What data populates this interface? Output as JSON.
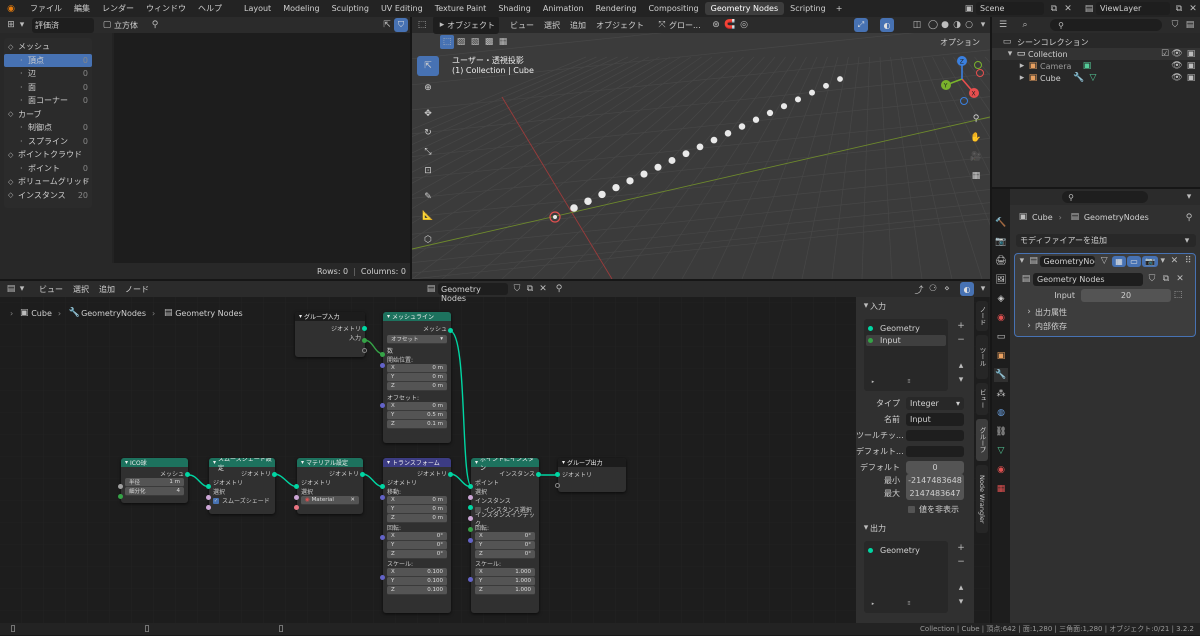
{
  "topbar": {
    "menus": [
      "ファイル",
      "編集",
      "レンダー",
      "ウィンドウ",
      "ヘルプ"
    ],
    "tabs": [
      "Layout",
      "Modeling",
      "Sculpting",
      "UV Editing",
      "Texture Paint",
      "Shading",
      "Animation",
      "Rendering",
      "Compositing",
      "Geometry Nodes",
      "Scripting"
    ],
    "active_tab": "Geometry Nodes",
    "plus": "+",
    "scene": "Scene",
    "view_layer": "ViewLayer"
  },
  "spreadsheet": {
    "mode": "評価済",
    "object": "立方体",
    "categories": [
      {
        "group": "メッシュ",
        "items": [
          {
            "label": "頂点",
            "count": "0"
          },
          {
            "label": "辺",
            "count": "0"
          },
          {
            "label": "面",
            "count": "0"
          },
          {
            "label": "面コーナー",
            "count": "0"
          }
        ]
      },
      {
        "group": "カーブ",
        "items": [
          {
            "label": "制御点",
            "count": "0"
          },
          {
            "label": "スプライン",
            "count": "0"
          }
        ]
      },
      {
        "group": "ポイントクラウド",
        "items": [
          {
            "label": "ポイント",
            "count": "0"
          }
        ]
      },
      {
        "group": "ボリュームグリッド",
        "items": [],
        "count": "0"
      },
      {
        "group": "インスタンス",
        "items": [],
        "count": "20"
      }
    ],
    "status": {
      "rows": "Rows: 0",
      "columns": "Columns: 0"
    }
  },
  "viewport": {
    "mode": "オブジェクト",
    "menus": [
      "ビュー",
      "選択",
      "追加",
      "オブジェクト"
    ],
    "transform": "グロー...",
    "options": "オプション",
    "view_label": "ユーザー・透視投影",
    "collection_label": "(1) Collection | Cube"
  },
  "outliner": {
    "title": "シーンコレクション",
    "collection": "Collection",
    "items": [
      "Camera",
      "Cube"
    ]
  },
  "properties": {
    "breadcrumb": [
      "Cube",
      "GeometryNodes"
    ],
    "add_modifier": "モディファイアーを追加",
    "modifier_name": "GeometryNod...",
    "node_group": "Geometry Nodes",
    "input_label": "Input",
    "input_value": "20",
    "panels": [
      "出力属性",
      "内部依存"
    ]
  },
  "node_editor": {
    "menus": [
      "ビュー",
      "選択",
      "追加",
      "ノード"
    ],
    "node_group": "Geometry Nodes",
    "breadcrumb": [
      "Cube",
      "GeometryNodes",
      "Geometry Nodes"
    ]
  },
  "nodes": {
    "group_input": {
      "title": "グループ入力",
      "rows": [
        "ジオメトリ",
        "入力"
      ]
    },
    "mesh_line": {
      "title": "メッシュライン",
      "out": "メッシュ",
      "mode": "オフセット",
      "count": "数",
      "start": "開始位置:",
      "start_vals": [
        [
          "X",
          "0 m"
        ],
        [
          "Y",
          "0 m"
        ],
        [
          "Z",
          "0 m"
        ]
      ],
      "offset": "オフセット:",
      "offset_vals": [
        [
          "X",
          "0 m"
        ],
        [
          "Y",
          "0.5 m"
        ],
        [
          "Z",
          "0.1 m"
        ]
      ]
    },
    "ico": {
      "title": "ICO球",
      "out": "メッシュ",
      "fields": [
        [
          "半径",
          "1 m"
        ],
        [
          "細分化",
          "4"
        ]
      ]
    },
    "smooth": {
      "title": "スムーズシェード設定",
      "out": "ジオメトリ",
      "rows": [
        "ジオメトリ",
        "選択"
      ],
      "check": "スムーズシェード"
    },
    "material": {
      "title": "マテリアル設定",
      "out": "ジオメトリ",
      "rows": [
        "ジオメトリ",
        "選択"
      ],
      "material": "Material"
    },
    "transform": {
      "title": "トランスフォーム",
      "out": "ジオメトリ",
      "in": "ジオメトリ",
      "move": "移動:",
      "move_vals": [
        [
          "X",
          "0 m"
        ],
        [
          "Y",
          "0 m"
        ],
        [
          "Z",
          "0 m"
        ]
      ],
      "rot": "回転:",
      "rot_vals": [
        [
          "X",
          "0°"
        ],
        [
          "Y",
          "0°"
        ],
        [
          "Z",
          "0°"
        ]
      ],
      "scale": "スケール:",
      "scale_vals": [
        [
          "X",
          "0.100"
        ],
        [
          "Y",
          "0.100"
        ],
        [
          "Z",
          "0.100"
        ]
      ]
    },
    "instance": {
      "title": "ポイントにインスタン",
      "out": "インスタンス",
      "rows": [
        "ポイント",
        "選択",
        "インスタンス"
      ],
      "check": "インスタンス選択",
      "idx": "インスタンスインデック",
      "rot": "回転:",
      "rot_vals": [
        [
          "X",
          "0°"
        ],
        [
          "Y",
          "0°"
        ],
        [
          "Z",
          "0°"
        ]
      ],
      "scale": "スケール:",
      "scale_vals": [
        [
          "X",
          "1.000"
        ],
        [
          "Y",
          "1.000"
        ],
        [
          "Z",
          "1.000"
        ]
      ]
    },
    "group_output": {
      "title": "グループ出力",
      "in": "ジオメトリ"
    }
  },
  "sidebar": {
    "inputs_title": "入力",
    "inputs": [
      "Geometry",
      "Input"
    ],
    "type_label": "タイプ",
    "type_value": "Integer",
    "name_label": "名前",
    "name_value": "Input",
    "tooltip_label": "ツールチッ...",
    "default_attr_label": "デフォルト...",
    "default_label": "デフォルト",
    "default_value": "0",
    "min_label": "最小",
    "min_value": "-2147483648",
    "max_label": "最大",
    "max_value": "2147483647",
    "hide_label": "値を非表示",
    "outputs_title": "出力",
    "outputs": [
      "Geometry"
    ],
    "vtabs": [
      "ノード",
      "ツール",
      "ビュー",
      "グループ",
      "Node Wrangler"
    ]
  },
  "statusbar": {
    "text": "Collection | Cube | 頂点:642 | 面:1,280 | 三角面:1,280 | オブジェクト:0/21 | 3.2.2"
  },
  "colors": {
    "geometry": "#00d6a3",
    "node_green": "#1d725e",
    "node_blue": "#3c3c83",
    "node_dark": "#1c1c1c"
  }
}
